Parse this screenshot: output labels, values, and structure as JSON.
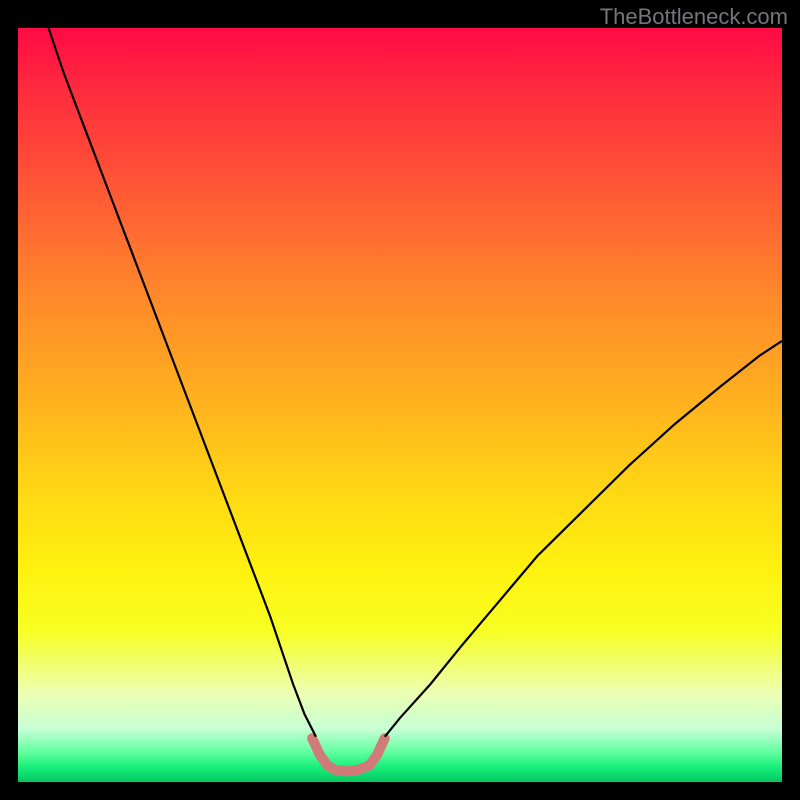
{
  "watermark": {
    "text": "TheBottleneck.com"
  },
  "chart_data": {
    "type": "line",
    "title": "",
    "xlabel": "",
    "ylabel": "",
    "xlim": [
      0,
      100
    ],
    "ylim": [
      0,
      100
    ],
    "background": {
      "gradient": "vertical",
      "stops": [
        {
          "pos": 0,
          "color": "#ff0a45"
        },
        {
          "pos": 8,
          "color": "#ff2a3e"
        },
        {
          "pos": 22,
          "color": "#ff5a35"
        },
        {
          "pos": 36,
          "color": "#ff8a2a"
        },
        {
          "pos": 50,
          "color": "#ffb31e"
        },
        {
          "pos": 62,
          "color": "#ffd914"
        },
        {
          "pos": 72,
          "color": "#fff20f"
        },
        {
          "pos": 80,
          "color": "#f7ff22"
        },
        {
          "pos": 88,
          "color": "#edffb0"
        },
        {
          "pos": 93,
          "color": "#c6ffd6"
        },
        {
          "pos": 96,
          "color": "#62ff9f"
        },
        {
          "pos": 98,
          "color": "#19f07a"
        },
        {
          "pos": 100,
          "color": "#04c763"
        }
      ]
    },
    "series": [
      {
        "name": "left-curve",
        "color": "#000000",
        "stroke_width": 2.2,
        "x": [
          4.0,
          6.0,
          9.0,
          12.0,
          15.0,
          18.0,
          21.0,
          24.0,
          27.0,
          30.0,
          33.0,
          36.0,
          37.5,
          39.0
        ],
        "values": [
          100.0,
          94.0,
          86.0,
          78.0,
          70.0,
          62.0,
          54.0,
          46.0,
          38.0,
          30.0,
          22.0,
          13.0,
          9.0,
          6.0
        ]
      },
      {
        "name": "right-curve",
        "color": "#000000",
        "stroke_width": 2.2,
        "x": [
          48.0,
          50.0,
          54.0,
          58.0,
          63.0,
          68.0,
          74.0,
          80.0,
          86.0,
          92.0,
          97.0,
          100.0
        ],
        "values": [
          6.0,
          8.5,
          13.0,
          18.0,
          24.0,
          30.0,
          36.0,
          42.0,
          47.5,
          52.5,
          56.5,
          58.5
        ]
      },
      {
        "name": "bottom-highlight",
        "color": "#d07a7a",
        "stroke_width": 10,
        "stroke_linecap": "round",
        "x": [
          38.5,
          39.5,
          40.5,
          41.5,
          43.0,
          44.5,
          46.0,
          47.0,
          48.0
        ],
        "values": [
          5.8,
          3.6,
          2.2,
          1.6,
          1.4,
          1.6,
          2.2,
          3.6,
          5.8
        ]
      }
    ]
  }
}
